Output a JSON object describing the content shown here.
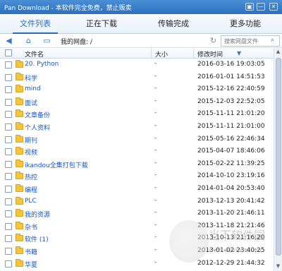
{
  "window": {
    "title": "Pan Download - 本软件完全免费，禁止贩卖",
    "buttons": [
      "▣",
      "—",
      "✕"
    ]
  },
  "tabs": [
    {
      "label": "文件列表",
      "active": true
    },
    {
      "label": "正在下载",
      "active": false
    },
    {
      "label": "传输完成",
      "active": false
    },
    {
      "label": "更多功能",
      "active": false
    }
  ],
  "pathbar": {
    "label": "我的网盘:  /",
    "search_placeholder": "搜索网盘文件"
  },
  "columns": {
    "name": "文件名",
    "size": "大小",
    "time": "修改时间"
  },
  "rows": [
    {
      "name": "20. Python",
      "size": "-",
      "time": "2016-03-16 19:03:05"
    },
    {
      "name": "科学",
      "size": "-",
      "time": "2016-01-01 14:51:53"
    },
    {
      "name": "mind",
      "size": "-",
      "time": "2015-12-16 22:40:59"
    },
    {
      "name": "面试",
      "size": "-",
      "time": "2015-12-03 22:52:05"
    },
    {
      "name": "文章备份",
      "size": "-",
      "time": "2015-11-11 21:01:20"
    },
    {
      "name": "个人资料",
      "size": "-",
      "time": "2015-11-11 21:01:00"
    },
    {
      "name": "期刊",
      "size": "-",
      "time": "2015-05-16 22:46:34"
    },
    {
      "name": "视频",
      "size": "-",
      "time": "2015-04-07 18:46:06"
    },
    {
      "name": "ikandou全集打包下载",
      "size": "-",
      "time": "2015-02-22 11:39:25"
    },
    {
      "name": "热控",
      "size": "-",
      "time": "2014-10-10 23:19:16"
    },
    {
      "name": "编程",
      "size": "-",
      "time": "2014-01-04 20:53:40"
    },
    {
      "name": "PLC",
      "size": "-",
      "time": "2013-12-13 20:41:42"
    },
    {
      "name": "我的资源",
      "size": "-",
      "time": "2013-11-20 21:46:11"
    },
    {
      "name": "杂书",
      "size": "-",
      "time": "2013-11-18 21:21:46"
    },
    {
      "name": "软件 (1)",
      "size": "-",
      "time": "2013-10-13 21:16:20"
    },
    {
      "name": "书籍",
      "size": "-",
      "time": "2013-01-02 23:40:25"
    },
    {
      "name": "华夏",
      "size": "-",
      "time": "2012-12-29 21:44:32"
    }
  ],
  "watermark": {
    "text": "当下软件园",
    "url": "www.downxia.com"
  }
}
